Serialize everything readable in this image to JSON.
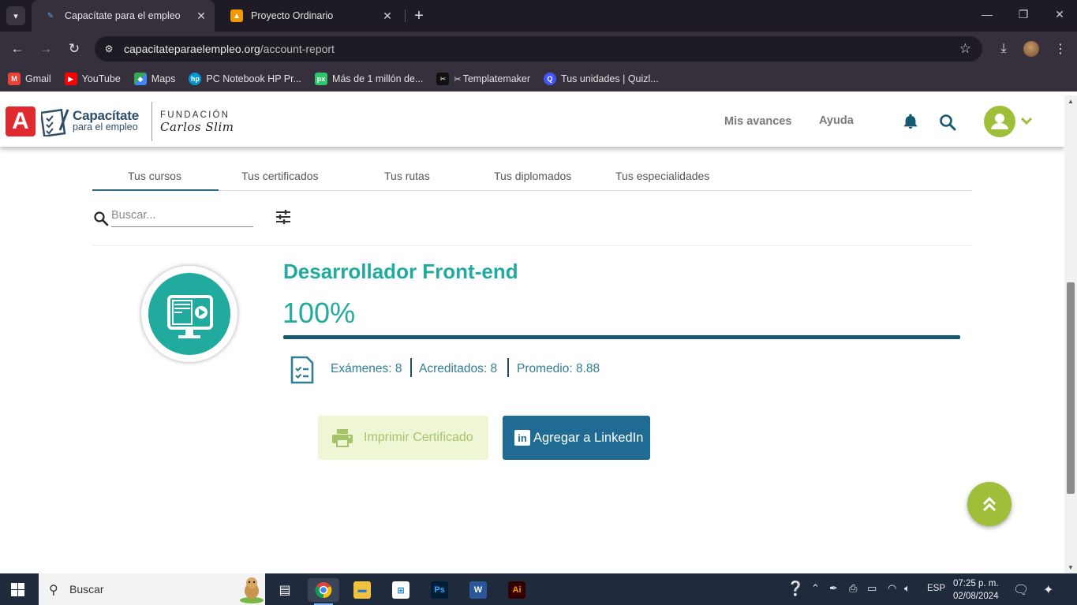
{
  "browser": {
    "tabs": [
      {
        "title": "Capacítate para el empleo",
        "active": true
      },
      {
        "title": "Proyecto Ordinario",
        "active": false
      }
    ],
    "url": {
      "domain": "capacitateparaelempleo.org",
      "path": "/account-report"
    },
    "bookmarks": [
      {
        "label": "Gmail",
        "icon": "gmail-icon",
        "color": "#ea4335"
      },
      {
        "label": "YouTube",
        "icon": "youtube-icon",
        "color": "#ff0000"
      },
      {
        "label": "Maps",
        "icon": "maps-icon",
        "color": "#34a853"
      },
      {
        "label": "PC Notebook HP Pr...",
        "icon": "hp-icon",
        "color": "#0096d6"
      },
      {
        "label": "Más de 1 millón de...",
        "icon": "pixabay-icon",
        "color": "#2ec66d"
      },
      {
        "label": "Templatemaker",
        "icon": "templatemaker-icon",
        "color": "#111111"
      },
      {
        "label": "Tus unidades | Quizl...",
        "icon": "quizlet-icon",
        "color": "#4255ff"
      }
    ]
  },
  "site": {
    "brand": {
      "badge": "A",
      "name_line1": "Capacítate",
      "name_line2": "para el empleo",
      "foundation_line1": "FUNDACIÓN",
      "foundation_line2": "Carlos Slim"
    },
    "nav": {
      "progress": "Mis avances",
      "help": "Ayuda"
    },
    "colors": {
      "teal": "#21ab9e",
      "green": "#9fbe3a",
      "navy": "#155a70",
      "linkedin": "#1f6b94"
    }
  },
  "tabs": [
    "Tus cursos",
    "Tus certificados",
    "Tus rutas",
    "Tus diplomados",
    "Tus especialidades"
  ],
  "search": {
    "placeholder": "Buscar..."
  },
  "course": {
    "title": "Desarrollador Front-end",
    "progress_label": "100%",
    "progress": 1.0,
    "stats": {
      "exams": "Exámenes: 8",
      "accredited": "Acreditados: 8",
      "average": "Promedio: 8.88"
    },
    "print_button": "Imprimir Certificado",
    "linkedin_button": "Agregar a LinkedIn"
  },
  "taskbar": {
    "search_label": "Buscar",
    "language": "ESP",
    "time": "07:25 p. m.",
    "date": "02/08/2024"
  }
}
